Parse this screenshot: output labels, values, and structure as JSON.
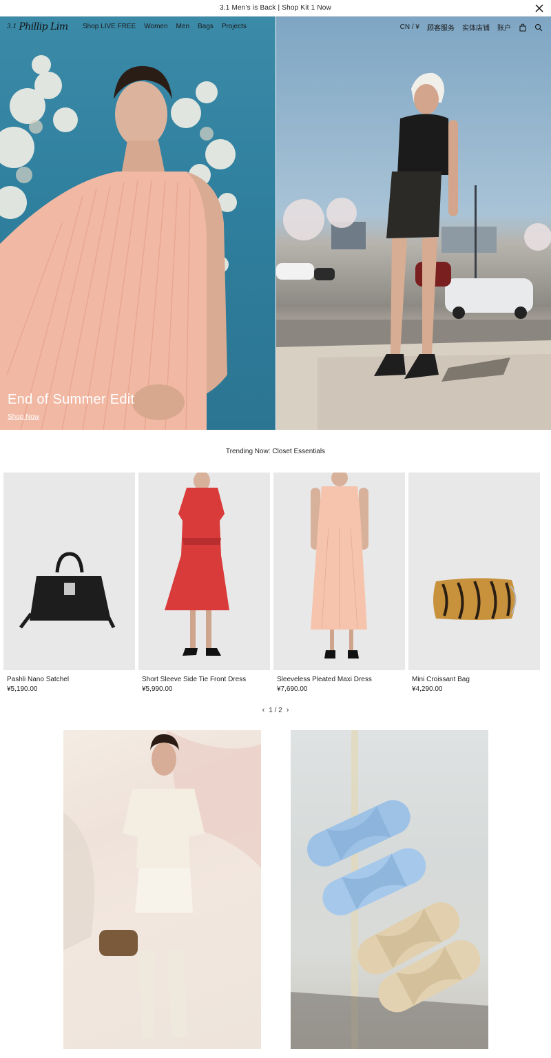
{
  "announcement": {
    "text": "3.1 Men's is Back | Shop Kit 1 Now"
  },
  "header": {
    "logo_number": "3.1",
    "logo_script": "Phillip Lim",
    "nav_left": [
      "Shop LIVE FREE",
      "Women",
      "Men",
      "Bags",
      "Projects"
    ],
    "locale": "CN / ¥",
    "customer_service": "顾客服务",
    "stores": "实体店铺",
    "account": "账户"
  },
  "hero": {
    "title": "End of Summer Edit",
    "link": "Shop Now"
  },
  "trending": {
    "title": "Trending Now: Closet Essentials",
    "products": [
      {
        "name": "Pashli Nano Satchel",
        "price": "¥5,190.00"
      },
      {
        "name": "Short Sleeve Side Tie Front Dress",
        "price": "¥5,990.00"
      },
      {
        "name": "Sleeveless Pleated Maxi Dress",
        "price": "¥7,690.00"
      },
      {
        "name": "Mini Croissant Bag",
        "price": "¥4,290.00"
      }
    ],
    "pager": "1 / 2"
  },
  "colors": {
    "sky_teal": "#2f7f9e",
    "dress_pink": "#f3b9a4",
    "product_bg": "#e8e8e8"
  }
}
